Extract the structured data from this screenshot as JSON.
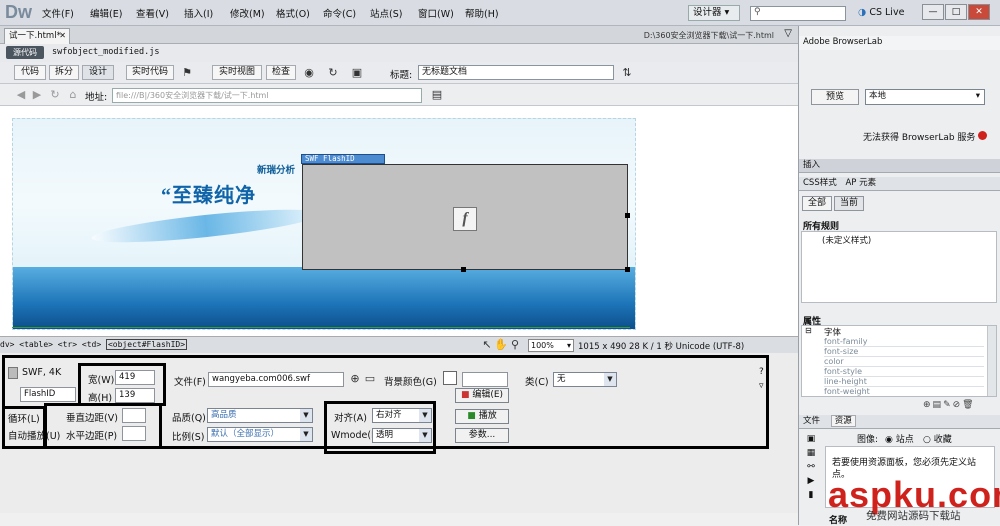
{
  "app": {
    "logo": "Dw"
  },
  "menubar": {
    "items": [
      "文件(F)",
      "编辑(E)",
      "查看(V)",
      "插入(I)",
      "修改(M)",
      "格式(O)",
      "命令(C)",
      "站点(S)",
      "窗口(W)",
      "帮助(H)"
    ],
    "mode": "设计器",
    "cs_live": "CS Live"
  },
  "window_controls": {
    "minimize": "—",
    "maximize": "□",
    "close": "✕"
  },
  "document": {
    "tab": "试一下.html*",
    "path": "D:\\360安全浏览器下载\\试一下.html",
    "related_button": "源代码",
    "related_file": "swfobject_modified.js"
  },
  "toolbar": {
    "code": "代码",
    "split": "拆分",
    "design": "设计",
    "live_code": "实时代码",
    "live_view": "实时视图",
    "inspect": "检查",
    "title_label": "标题:",
    "title_value": "无标题文档"
  },
  "address": {
    "label": "地址:",
    "value": "file:///B|/360安全浏览器下载/试一下.html"
  },
  "canvas": {
    "banner_sub": "新瑞分析",
    "banner_title": "“至臻纯净",
    "flash_tag": "SWF  FlashID",
    "flash_letter": "f"
  },
  "tagbar": {
    "path": "dv> <table> <tr> <td>",
    "selected": "<object#FlashID>",
    "zoom": "100%",
    "status": "1015 x 490  28 K / 1 秒  Unicode (UTF-8)"
  },
  "properties": {
    "type": "SWF, 4K",
    "id": "FlashID",
    "width_label": "宽(W)",
    "width": "419",
    "height_label": "高(H)",
    "height": "139",
    "file_label": "文件(F)",
    "file": "wangyeba.com006.swf",
    "bgcolor_label": "背景颜色(G)",
    "edit_button": "编辑(E)",
    "class_label": "类(C)",
    "class_value": "无",
    "loop_label": "循环(L)",
    "autoplay_label": "自动播放(U)",
    "vspace_label": "垂直边距(V)",
    "hspace_label": "水平边距(P)",
    "quality_label": "品质(Q)",
    "quality_value": "高品质",
    "scale_label": "比例(S)",
    "scale_value": "默认（全部显示）",
    "align_label": "对齐(A)",
    "align_value": "右对齐",
    "wmode_label": "Wmode(M)",
    "wmode_value": "透明",
    "play_button": "播放",
    "params_button": "参数..."
  },
  "right_panel": {
    "browserlab_title": "Adobe BrowserLab",
    "preview_button": "预览",
    "local_select": "本地",
    "browserlab_status": "无法获得 BrowserLab 服务",
    "insert_header": "插入",
    "css_tab": "CSS样式",
    "ap_tab": "AP 元素",
    "all_tab": "全部",
    "current_tab": "当前",
    "all_rules": "所有规则",
    "undefined_style": "(未定义样式)",
    "attributes_header": "属性",
    "font_group": "字体",
    "font_props": [
      "font-family",
      "font-size",
      "color",
      "font-style",
      "line-height",
      "font-weight"
    ],
    "files_tab": "文件",
    "assets_tab": "资源",
    "image_label": "图像:",
    "site_radio": "站点",
    "favorites_radio": "收藏",
    "assets_msg": "若要使用资源面板，您必须先定义站点。",
    "name_label": "名称"
  },
  "watermark": {
    "brand": "aspku.com",
    "sub": "免费网站源码下载站"
  },
  "colors": {
    "accent": "#4d8bd0",
    "highlight_border": "#000000",
    "status_red": "#d0221c"
  }
}
